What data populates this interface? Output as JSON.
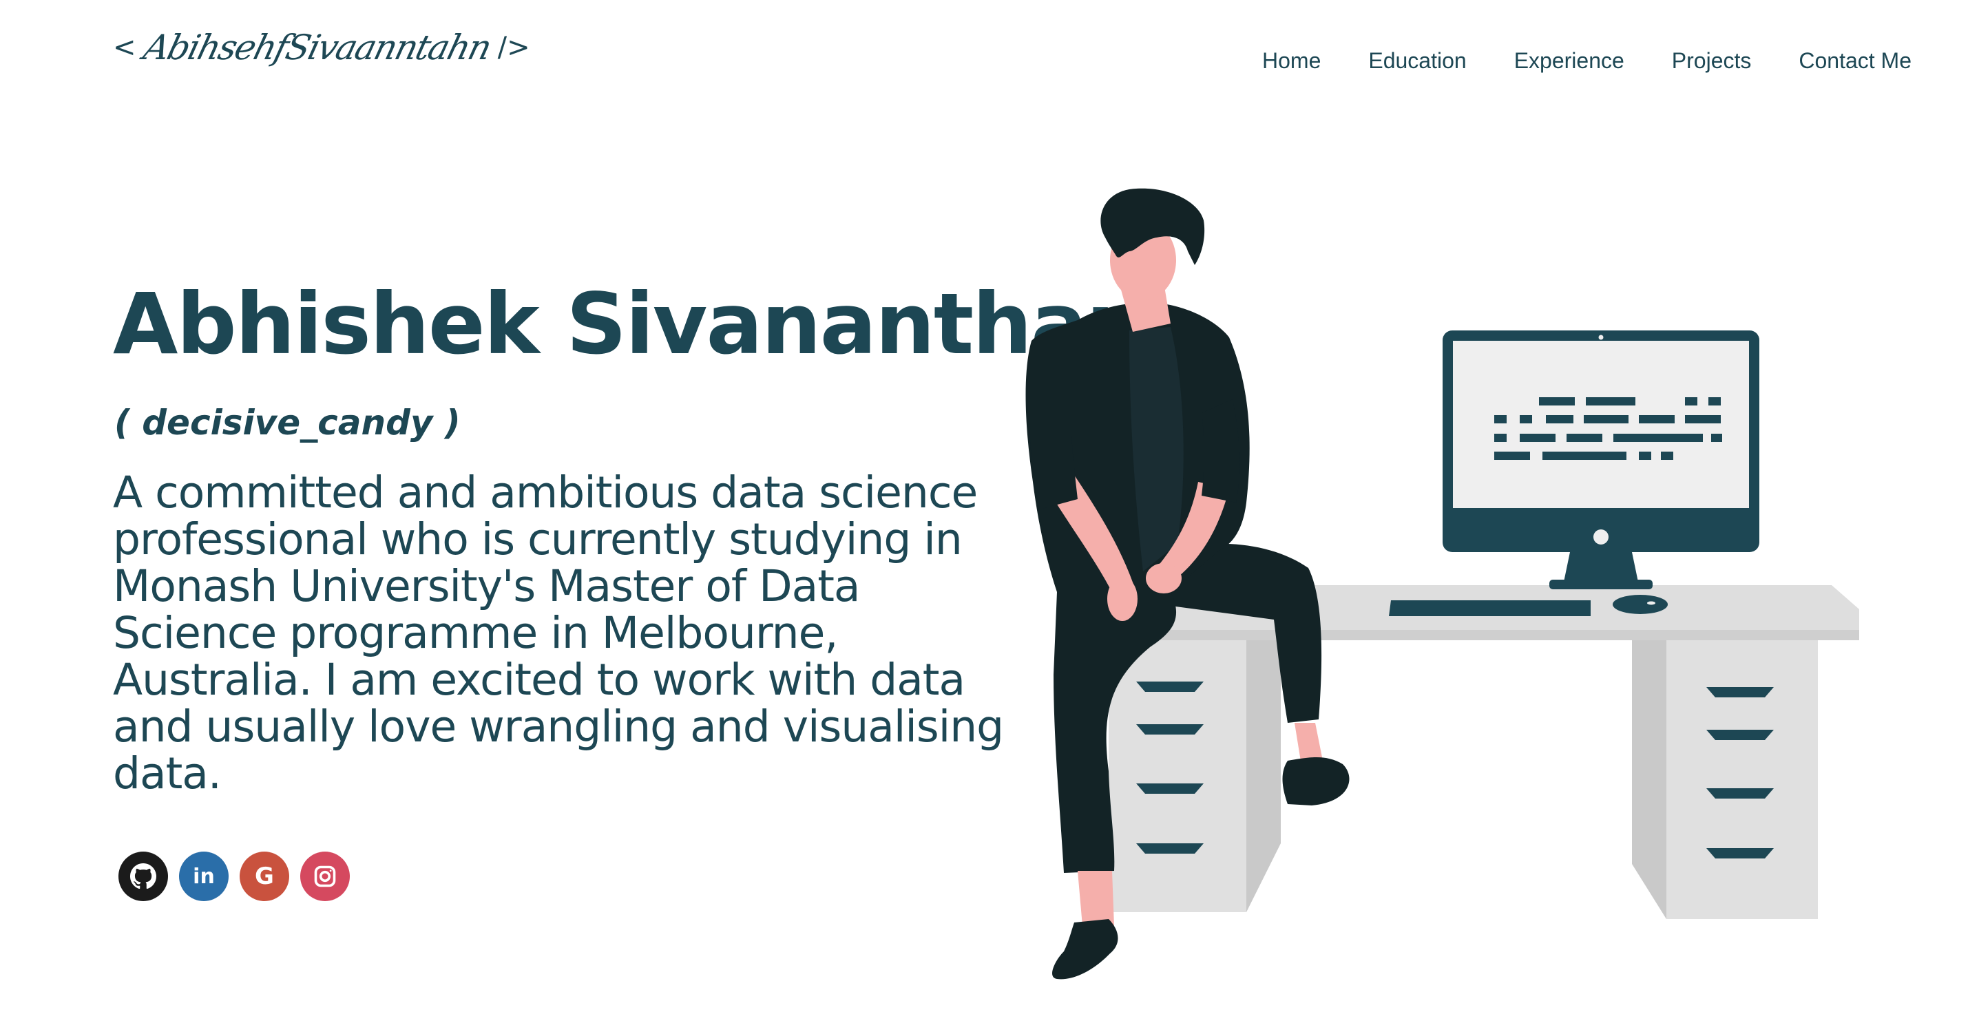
{
  "header": {
    "logo": {
      "open_bracket": "<",
      "signature": "AbihsehfSivaanntahn",
      "close_bracket": "/>"
    },
    "nav": [
      {
        "label": "Home"
      },
      {
        "label": "Education"
      },
      {
        "label": "Experience"
      },
      {
        "label": "Projects"
      },
      {
        "label": "Contact Me"
      }
    ]
  },
  "hero": {
    "name": "Abhishek Sivananthan",
    "alias": "( decisive_candy )",
    "bio": "A committed and ambitious data science professional who is currently studying in Monash University's Master of Data Science programme in Melbourne, Australia. I am excited to work with data and usually love wrangling and visualising data.",
    "socials": [
      {
        "icon": "github-icon",
        "color": "#1b1b1b"
      },
      {
        "icon": "linkedin-icon",
        "glyph": "in",
        "color": "#2a6ea9"
      },
      {
        "icon": "google-icon",
        "glyph": "G",
        "color": "#c9523e"
      },
      {
        "icon": "instagram-icon",
        "color": "#d5495f"
      }
    ]
  },
  "colors": {
    "primary": "#1d4754",
    "background": "#ffffff",
    "desk": "#e0e0e0",
    "skin": "#f5afab",
    "clothing": "#132326"
  }
}
